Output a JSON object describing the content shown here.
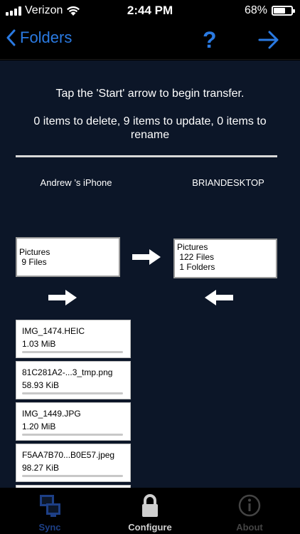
{
  "status_bar": {
    "carrier": "Verizon",
    "time": "2:44 PM",
    "battery_text": "68%",
    "battery_level": 0.68,
    "icons": [
      "signal-icon",
      "wifi-icon",
      "battery-icon"
    ]
  },
  "nav": {
    "back_label": "Folders",
    "help_label": "?",
    "accent_color": "#2a7ae2",
    "icons": [
      "chevron-left-icon",
      "arrow-right-icon"
    ]
  },
  "main": {
    "instruction": "Tap the 'Start' arrow to begin transfer.",
    "summary": "0 items to delete, 9 items to update, 0 items to rename",
    "left_device": "Andrew ’s iPhone",
    "right_device": "BRIANDESKTOP",
    "left_folder": {
      "name": "Pictures",
      "files": " 9 Files"
    },
    "right_folder": {
      "name": "Pictures",
      "files": " 122 Files",
      "folders": " 1 Folders"
    },
    "files": [
      {
        "name": "IMG_1474.HEIC",
        "size": "1.03 MiB"
      },
      {
        "name": "81C281A2-...3_tmp.png",
        "size": "58.93 KiB"
      },
      {
        "name": "IMG_1449.JPG",
        "size": "1.20 MiB"
      },
      {
        "name": "F5AA7B70...B0E57.jpeg",
        "size": "98.27 KiB"
      }
    ]
  },
  "tabs": {
    "sync": "Sync",
    "configure": "Configure",
    "about": "About",
    "selected": "sync"
  }
}
